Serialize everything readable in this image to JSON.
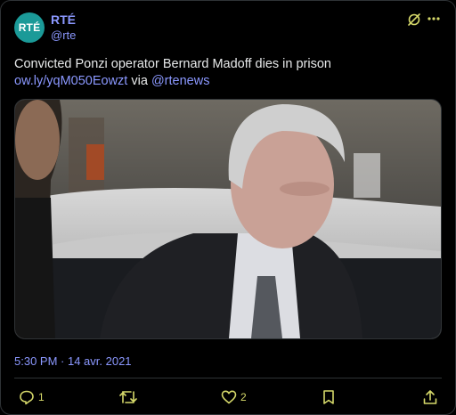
{
  "account": {
    "avatar_text": "RTÉ",
    "name": "RTÉ",
    "handle": "@rte",
    "avatar_color": "#1b9a98"
  },
  "header_icons": [
    "grok-icon",
    "more-icon"
  ],
  "tweet": {
    "text": "Convicted Ponzi operator Bernard Madoff dies in prison",
    "link": "ow.ly/yqM050Eowzt",
    "via_word": "via",
    "mention": "@rtenews"
  },
  "timestamp": "5:30 PM · 14 avr. 2021",
  "actions": {
    "reply_count": "1",
    "like_count": "2"
  },
  "colors": {
    "accent": "#8b98ff",
    "icon": "#d6d96a",
    "background": "#000000"
  }
}
